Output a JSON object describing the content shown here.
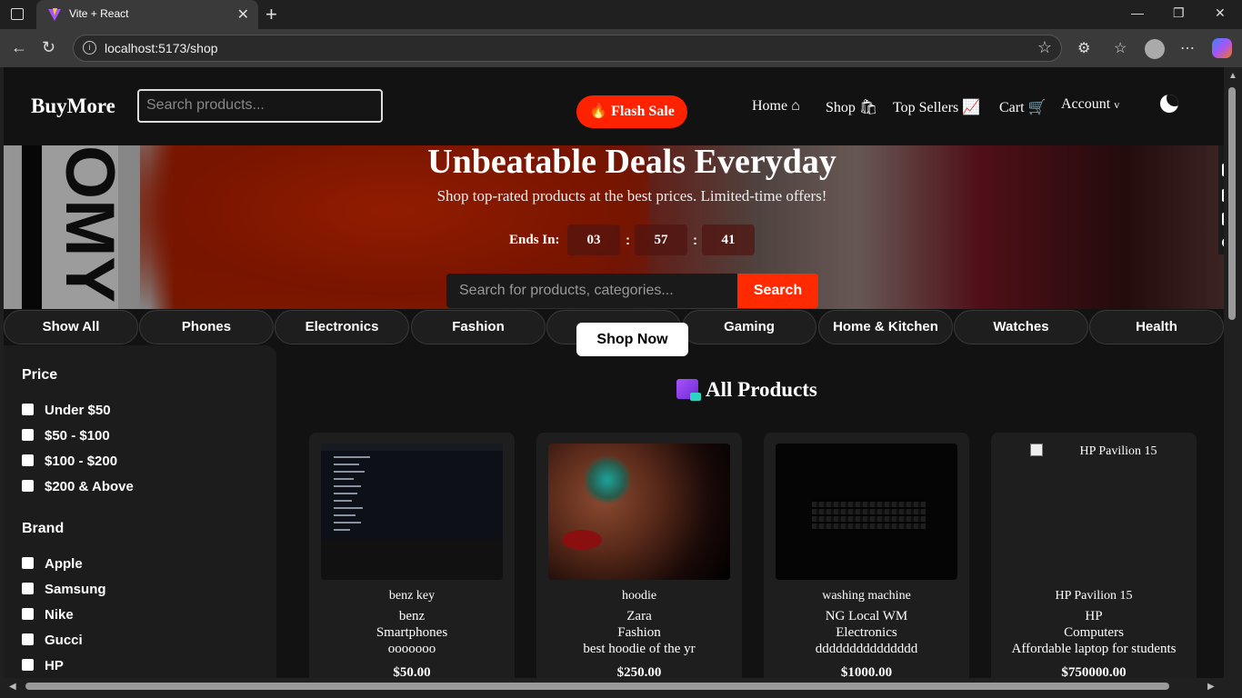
{
  "browser": {
    "tab_title": "Vite + React",
    "url": "localhost:5173/shop"
  },
  "nav": {
    "logo": "BuyMore",
    "search_placeholder": "Search products...",
    "flash_sale": "🔥 Flash Sale",
    "links": [
      "Home",
      "Shop",
      "Top Sellers",
      "Cart",
      "Account"
    ],
    "link_icons": [
      "home-icon",
      "shopping-bag-icon",
      "chart-icon",
      "cart-icon",
      "chevron-down-icon"
    ]
  },
  "hero": {
    "title": "Unbeatable Deals Everyday",
    "subtitle": "Shop top-rated products at the best prices. Limited-time offers!",
    "ends_label": "Ends In:",
    "countdown": [
      "03",
      "57",
      "41"
    ],
    "search_placeholder": "Search for products, categories...",
    "search_button": "Search",
    "background_letters": "OMY"
  },
  "categories": [
    "Show All",
    "Phones",
    "Electronics",
    "Fashion",
    "",
    "Gaming",
    "Home & Kitchen",
    "Watches",
    "Health"
  ],
  "shop_now": "Shop Now",
  "filters": {
    "price_heading": "Price",
    "price_options": [
      "Under $50",
      "$50 - $100",
      "$100 - $200",
      "$200 & Above"
    ],
    "brand_heading": "Brand",
    "brand_options": [
      "Apple",
      "Samsung",
      "Nike",
      "Gucci",
      "HP"
    ]
  },
  "products_heading": "All Products",
  "products": [
    {
      "name": "benz key",
      "brand": "benz",
      "category": "Smartphones",
      "description": "ooooooo",
      "price": "$50.00"
    },
    {
      "name": "hoodie",
      "brand": "Zara",
      "category": "Fashion",
      "description": "best hoodie of the yr",
      "price": "$250.00"
    },
    {
      "name": "washing machine",
      "brand": "NG Local WM",
      "category": "Electronics",
      "description": "ddddddddddddddd",
      "price": "$1000.00"
    },
    {
      "name": "HP Pavilion 15",
      "brand": "HP",
      "category": "Computers",
      "description": "Affordable laptop for students",
      "price": "$750000.00",
      "image_alt": "HP Pavilion 15"
    }
  ],
  "colors": {
    "accent": "#ff2a00",
    "page_bg": "#121212",
    "card_bg": "#1e1e1e"
  }
}
